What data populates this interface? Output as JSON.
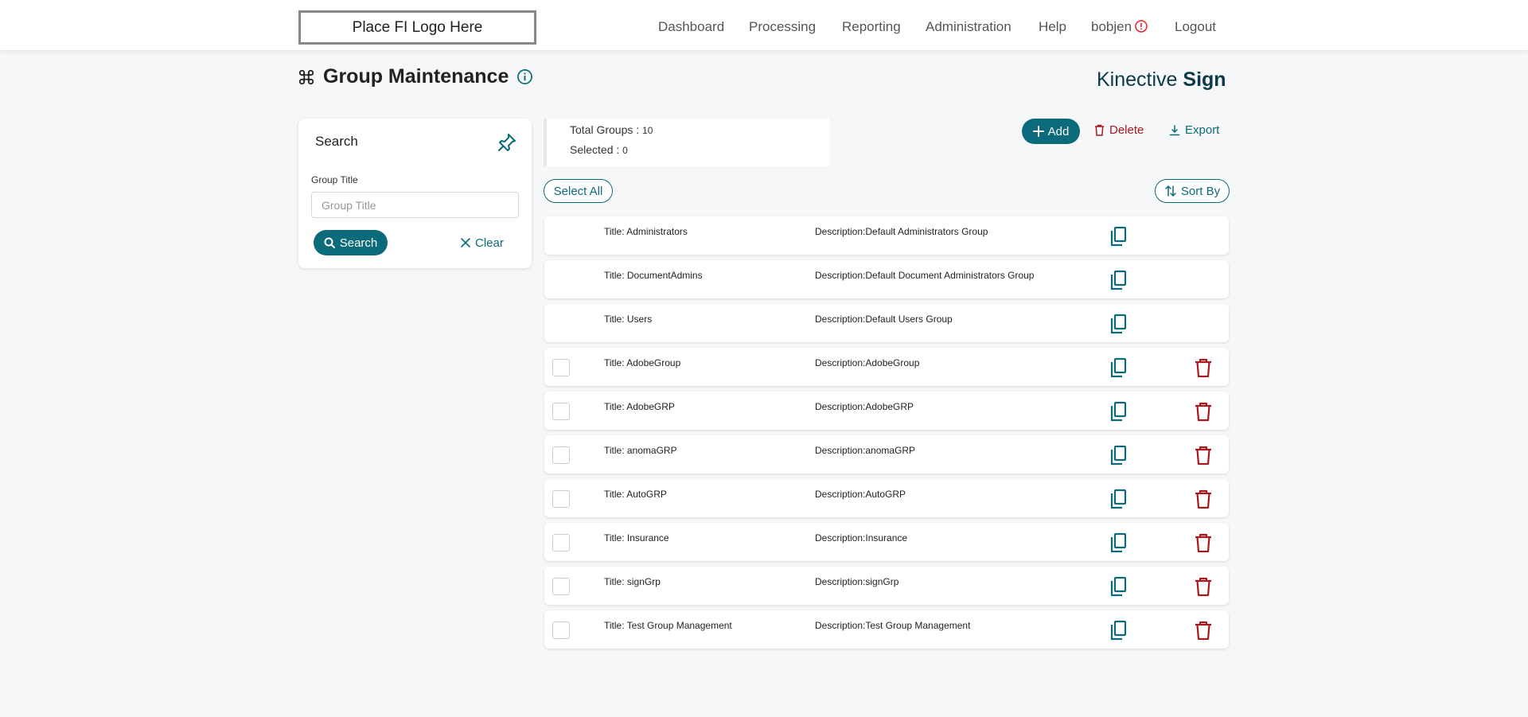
{
  "header": {
    "logo_text": "Place FI Logo Here",
    "nav": [
      {
        "label": "Dashboard"
      },
      {
        "label": "Processing"
      },
      {
        "label": "Reporting"
      },
      {
        "label": "Administration"
      },
      {
        "label": "Help"
      },
      {
        "label": "bobjen"
      },
      {
        "label": "Logout"
      }
    ]
  },
  "page": {
    "title": "Group Maintenance",
    "brand_light": "Kinective ",
    "brand_bold": "Sign"
  },
  "search": {
    "title": "Search",
    "field_label": "Group Title",
    "field_placeholder": "Group Title",
    "field_value": "",
    "search_label": "Search",
    "clear_label": "Clear"
  },
  "summary": {
    "total_label": "Total Groups : ",
    "total_value": "10",
    "selected_label": "Selected : ",
    "selected_value": "0"
  },
  "actions": {
    "add_label": "Add",
    "delete_label": "Delete",
    "export_label": "Export",
    "select_all_label": "Select All",
    "sort_by_label": "Sort By"
  },
  "colors": {
    "accent": "#0c6b7a",
    "danger": "#a8191e"
  },
  "groups": [
    {
      "title": "Title: Administrators",
      "description": "Description:Default Administrators Group",
      "selectable": false,
      "deletable": false
    },
    {
      "title": "Title: DocumentAdmins",
      "description": "Description:Default Document Administrators Group",
      "selectable": false,
      "deletable": false
    },
    {
      "title": "Title: Users",
      "description": "Description:Default Users Group",
      "selectable": false,
      "deletable": false
    },
    {
      "title": "Title: AdobeGroup",
      "description": "Description:AdobeGroup",
      "selectable": true,
      "deletable": true
    },
    {
      "title": "Title: AdobeGRP",
      "description": "Description:AdobeGRP",
      "selectable": true,
      "deletable": true
    },
    {
      "title": "Title: anomaGRP",
      "description": "Description:anomaGRP",
      "selectable": true,
      "deletable": true
    },
    {
      "title": "Title: AutoGRP",
      "description": "Description:AutoGRP",
      "selectable": true,
      "deletable": true
    },
    {
      "title": "Title: Insurance",
      "description": "Description:Insurance",
      "selectable": true,
      "deletable": true
    },
    {
      "title": "Title: signGrp",
      "description": "Description:signGrp",
      "selectable": true,
      "deletable": true
    },
    {
      "title": "Title: Test Group Management",
      "description": "Description:Test Group Management",
      "selectable": true,
      "deletable": true
    }
  ]
}
